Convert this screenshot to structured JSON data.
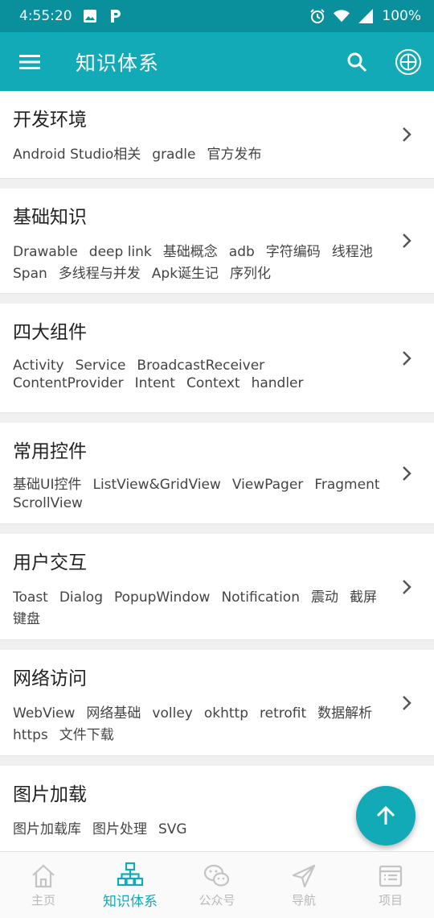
{
  "status_bar": {
    "time": "4:55:20",
    "battery": "100%"
  },
  "toolbar": {
    "title": "知识体系"
  },
  "categories": [
    {
      "title": "开发环境",
      "tags": [
        "Android Studio相关",
        "gradle",
        "官方发布"
      ]
    },
    {
      "title": "基础知识",
      "tags": [
        "Drawable",
        "deep link",
        "基础概念",
        "adb",
        "字符编码",
        "线程池",
        "Span",
        "多线程与并发",
        "Apk诞生记",
        "序列化"
      ]
    },
    {
      "title": "四大组件",
      "tags": [
        "Activity",
        "Service",
        "BroadcastReceiver",
        "ContentProvider",
        "Intent",
        "Context",
        "handler"
      ]
    },
    {
      "title": "常用控件",
      "tags": [
        "基础UI控件",
        "ListView&GridView",
        "ViewPager",
        "Fragment",
        "ScrollView"
      ]
    },
    {
      "title": "用户交互",
      "tags": [
        "Toast",
        "Dialog",
        "PopupWindow",
        "Notification",
        "震动",
        "截屏",
        "键盘"
      ]
    },
    {
      "title": "网络访问",
      "tags": [
        "WebView",
        "网络基础",
        "volley",
        "okhttp",
        "retrofit",
        "数据解析",
        "https",
        "文件下载"
      ]
    },
    {
      "title": "图片加载",
      "tags": [
        "图片加载库",
        "图片处理",
        "SVG"
      ]
    }
  ],
  "bottom_nav": [
    {
      "label": "主页",
      "icon": "home-icon"
    },
    {
      "label": "知识体系",
      "icon": "hierarchy-icon",
      "active": true
    },
    {
      "label": "公众号",
      "icon": "wechat-icon"
    },
    {
      "label": "导航",
      "icon": "navigation-icon"
    },
    {
      "label": "项目",
      "icon": "project-icon"
    }
  ],
  "colors": {
    "primary": "#13aab8",
    "primary_dark": "#0a8f9d",
    "inactive": "#b9b9b9"
  }
}
